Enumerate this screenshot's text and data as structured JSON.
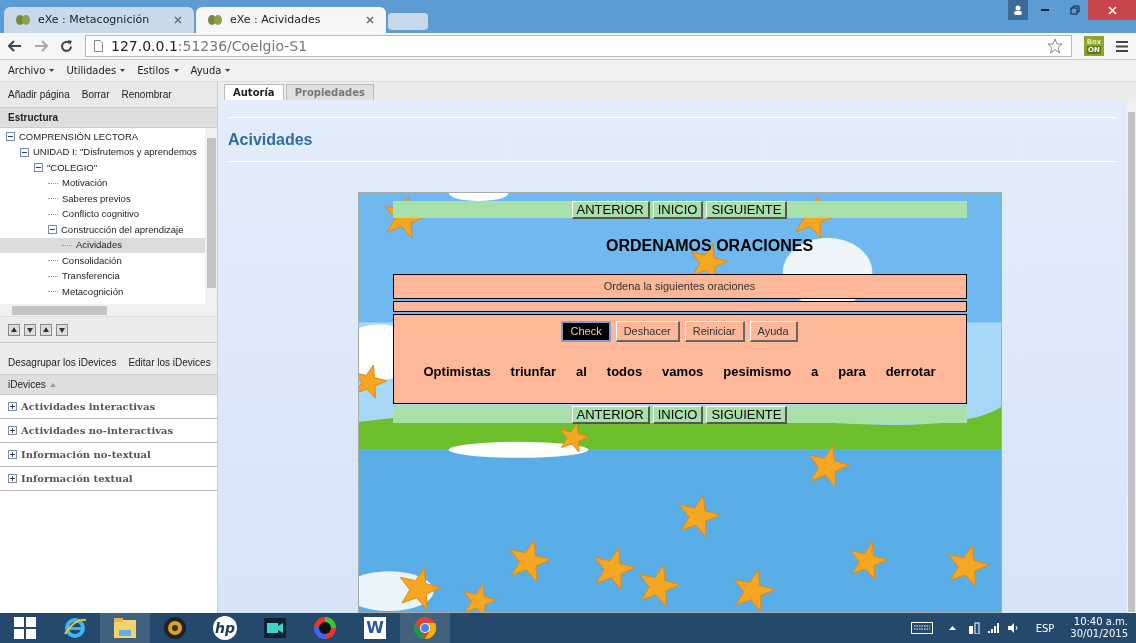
{
  "browser": {
    "tabs": [
      {
        "title": "eXe : Metacognición",
        "selected": false
      },
      {
        "title": "eXe : Acividades",
        "selected": true
      }
    ],
    "url_host": "127.0.0.1",
    "url_rest": ":51236/Coelgio-S1",
    "extension": [
      "Box",
      "ON"
    ]
  },
  "menu": [
    "Archivo",
    "Utilidades",
    "Estilos",
    "Ayuda"
  ],
  "toolbar": [
    "Añadir página",
    "Borrar",
    "Renombrar"
  ],
  "structure": {
    "title": "Estructura",
    "tree": [
      {
        "label": "COMPRENSIÓN LECTORA",
        "expanded": true,
        "selected": false,
        "children": [
          {
            "label": "UNIDAD I: \"Disfrutemos y aprendemos",
            "expanded": true,
            "selected": false,
            "children": [
              {
                "label": "\"COLEGIO\"",
                "expanded": true,
                "selected": false,
                "children": [
                  {
                    "label": "Motivación",
                    "selected": false
                  },
                  {
                    "label": "Saberes previos",
                    "selected": false
                  },
                  {
                    "label": "Conflicto cognitivo",
                    "selected": false
                  },
                  {
                    "label": "Construcción del aprendizaje",
                    "expanded": true,
                    "selected": false,
                    "children": [
                      {
                        "label": "Acividades",
                        "selected": true
                      }
                    ]
                  },
                  {
                    "label": "Consolidación",
                    "selected": false
                  },
                  {
                    "label": "Transferencia",
                    "selected": false
                  },
                  {
                    "label": "Metacognición",
                    "selected": false
                  }
                ]
              }
            ]
          }
        ]
      }
    ]
  },
  "idevice_actions": [
    "Desagrupar los iDevices",
    "Editar los iDevices"
  ],
  "idevices": {
    "title": "iDevices",
    "groups": [
      {
        "label": "Actividades interactivas",
        "expanded": false
      },
      {
        "label": "Actividades no-interactivas",
        "expanded": false
      },
      {
        "label": "Información no-textual",
        "expanded": false
      },
      {
        "label": "Información textual",
        "expanded": false
      }
    ]
  },
  "content_tabs": [
    {
      "label": "Autoría",
      "selected": true
    },
    {
      "label": "Propiedades",
      "selected": false
    }
  ],
  "page_title": "Acividades",
  "activity": {
    "nav_top": [
      "ANTERIOR",
      "INICIO",
      "SIGUIENTE"
    ],
    "heading": "ORDENAMOS ORACIONES",
    "instruction": "Ordena la siguientes oraciones",
    "buttons": [
      {
        "label": "Check",
        "selected": true
      },
      {
        "label": "Deshacer",
        "selected": false
      },
      {
        "label": "Reiniciar",
        "selected": false
      },
      {
        "label": "Ayuda",
        "selected": false
      }
    ],
    "words": [
      "Optimistas",
      "triunfar",
      "al",
      "todos",
      "vamos",
      "pesimismo",
      "a",
      "para",
      "derrotar"
    ],
    "nav_bottom": [
      "ANTERIOR",
      "INICIO",
      "SIGUIENTE"
    ]
  },
  "taskbar": {
    "apps": [
      {
        "kind": "windows"
      },
      {
        "kind": "ie"
      },
      {
        "kind": "folder"
      },
      {
        "kind": "webcam"
      },
      {
        "kind": "hp",
        "label": "hp"
      },
      {
        "kind": "video"
      },
      {
        "kind": "camera"
      },
      {
        "kind": "word",
        "label": "W"
      },
      {
        "kind": "chrome"
      }
    ],
    "language": "ESP",
    "time": "10:40 a.m.",
    "date": "30/01/2015"
  }
}
